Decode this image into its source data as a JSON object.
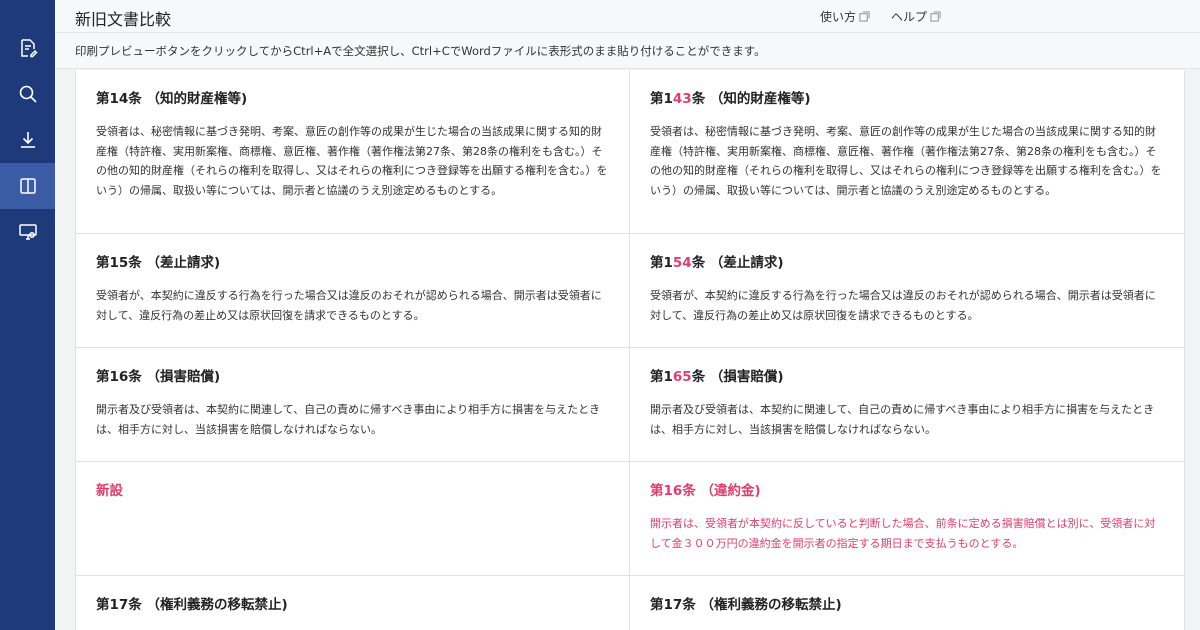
{
  "header": {
    "title": "新旧文書比較",
    "usage_label": "使い方",
    "help_label": "ヘルプ"
  },
  "info": {
    "message": "印刷プレビューボタンをクリックしてからCtrl+Aで全文選択し、Ctrl+CでWordファイルに表形式のまま貼り付けることができます。"
  },
  "sidebar": {
    "items": [
      {
        "icon": "document-edit-icon"
      },
      {
        "icon": "search-icon"
      },
      {
        "icon": "download-icon"
      },
      {
        "icon": "compare-icon",
        "active": true
      },
      {
        "icon": "presentation-settings-icon"
      }
    ]
  },
  "colors": {
    "sidebar": "#1e3a7a",
    "sidebar_active": "#3a5ba5",
    "diff": "#e03c6c"
  },
  "rows": [
    {
      "left": {
        "title": "第14条 （知的財産権等)",
        "body": "受領者は、秘密情報に基づき発明、考案、意匠の創作等の成果が生じた場合の当該成果に関する知的財産権（特許権、実用新案権、商標権、意匠権、著作権（著作権法第27条、第28条の権利をも含む。）その他の知的財産権（それらの権利を取得し、又はそれらの権利につき登録等を出願する権利を含む。）をいう）の帰属、取扱い等については、開示者と協議のうえ別途定めるものとする。"
      },
      "right": {
        "title_pre": "第1",
        "title_diff": "43",
        "title_post": "条 （知的財産権等)",
        "body": "受領者は、秘密情報に基づき発明、考案、意匠の創作等の成果が生じた場合の当該成果に関する知的財産権（特許権、実用新案権、商標権、意匠権、著作権（著作権法第27条、第28条の権利をも含む。）その他の知的財産権（それらの権利を取得し、又はそれらの権利につき登録等を出願する権利を含む。）をいう）の帰属、取扱い等については、開示者と協議のうえ別途定めるものとする。"
      }
    },
    {
      "left": {
        "title": "第15条 （差止請求)",
        "body": "受領者が、本契約に違反する行為を行った場合又は違反のおそれが認められる場合、開示者は受領者に対して、違反行為の差止め又は原状回復を請求できるものとする。"
      },
      "right": {
        "title_pre": "第1",
        "title_diff": "54",
        "title_post": "条 （差止請求)",
        "body": "受領者が、本契約に違反する行為を行った場合又は違反のおそれが認められる場合、開示者は受領者に対して、違反行為の差止め又は原状回復を請求できるものとする。"
      }
    },
    {
      "left": {
        "title": "第16条 （損害賠償)",
        "body": "開示者及び受領者は、本契約に関連して、自己の責めに帰すべき事由により相手方に損害を与えたときは、相手方に対し、当該損害を賠償しなければならない。"
      },
      "right": {
        "title_pre": "第1",
        "title_diff": "65",
        "title_post": "条 （損害賠償)",
        "body": "開示者及び受領者は、本契約に関連して、自己の責めに帰すべき事由により相手方に損害を与えたときは、相手方に対し、当該損害を賠償しなければならない。"
      }
    },
    {
      "left": {
        "title": "新設"
      },
      "right": {
        "title": "第16条 （違約金)",
        "body": "開示者は、受領者が本契約に反していると判断した場合、前条に定める損害賠償とは別に、受領者に対して金３００万円の違約金を開示者の指定する期日まで支払うものとする。"
      }
    },
    {
      "left": {
        "title": "第17条 （権利義務の移転禁止)"
      },
      "right": {
        "title": "第17条 （権利義務の移転禁止)"
      }
    }
  ]
}
